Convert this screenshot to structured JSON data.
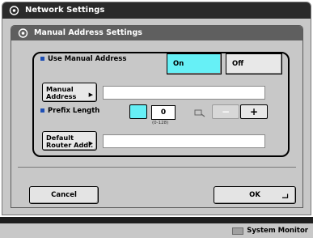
{
  "window": {
    "title": "Network Settings"
  },
  "dialog": {
    "title": "Manual Address Settings"
  },
  "use_manual": {
    "label": "Use Manual Address",
    "on_label": "On",
    "off_label": "Off",
    "selected": "On"
  },
  "manual_address": {
    "button_label_1": "Manual",
    "button_label_2": "Address",
    "value": ""
  },
  "prefix_length": {
    "label": "Prefix Length",
    "value": "0",
    "range": "(0-128)",
    "minus": "−",
    "plus": "+"
  },
  "default_router": {
    "button_label_1": "Default",
    "button_label_2": "Router Addr.",
    "value": ""
  },
  "footer": {
    "cancel_label": "Cancel",
    "ok_label": "OK"
  },
  "status": {
    "system_monitor_label": "System Monitor"
  },
  "colors": {
    "accent": "#66f0f6",
    "bullet": "#1e4fb5"
  }
}
